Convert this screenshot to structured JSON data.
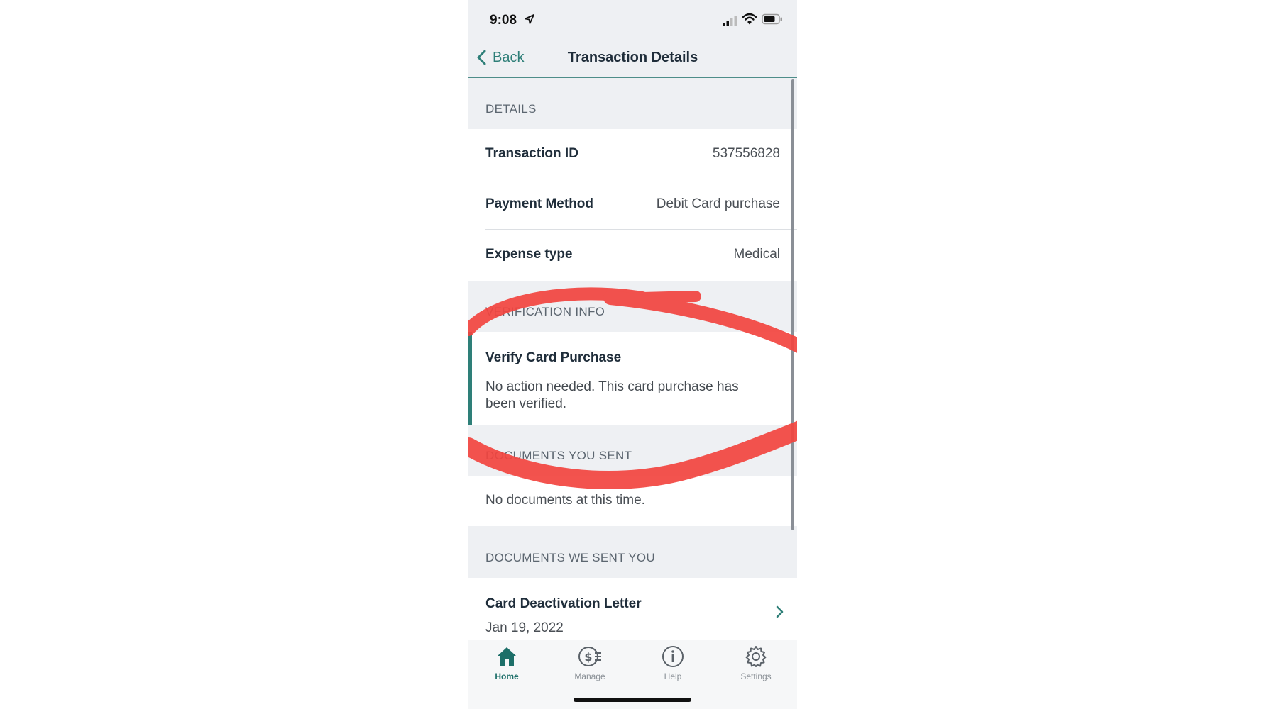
{
  "status_bar": {
    "time": "9:08",
    "icons": [
      "location-arrow-icon",
      "cellular-signal-icon",
      "wifi-icon",
      "battery-icon"
    ]
  },
  "nav": {
    "back_label": "Back",
    "title": "Transaction Details"
  },
  "sections": {
    "details": {
      "header": "DETAILS",
      "rows": [
        {
          "label": "Transaction ID",
          "value": "537556828"
        },
        {
          "label": "Payment Method",
          "value": "Debit Card purchase"
        },
        {
          "label": "Expense type",
          "value": "Medical"
        }
      ]
    },
    "verification": {
      "header": "VERIFICATION INFO",
      "card_title": "Verify Card Purchase",
      "card_text": "No action needed. This card purchase has been verified."
    },
    "documents_you_sent": {
      "header": "DOCUMENTS YOU SENT",
      "empty_text": "No documents at this time."
    },
    "documents_we_sent": {
      "header": "DOCUMENTS WE SENT YOU",
      "items": [
        {
          "title": "Card Deactivation Letter",
          "date": "Jan 19, 2022"
        }
      ]
    }
  },
  "tabbar": {
    "tabs": [
      {
        "label": "Home",
        "icon": "home-icon",
        "active": true
      },
      {
        "label": "Manage",
        "icon": "manage-dollar-icon",
        "active": false
      },
      {
        "label": "Help",
        "icon": "info-icon",
        "active": false
      },
      {
        "label": "Settings",
        "icon": "gear-icon",
        "active": false
      }
    ]
  },
  "colors": {
    "accent": "#2e7f78",
    "annotation_red": "#f2443f",
    "background": "#eef0f3"
  }
}
